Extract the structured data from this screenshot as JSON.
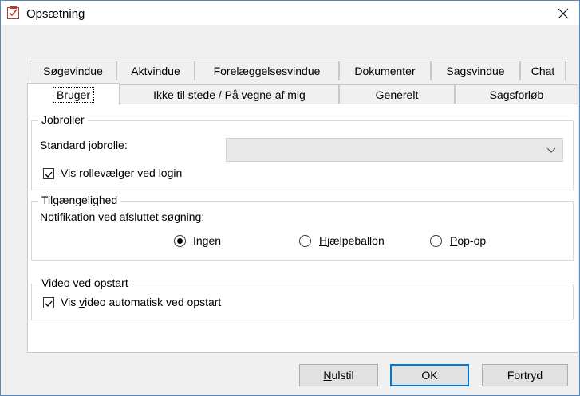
{
  "window": {
    "title": "Opsætning"
  },
  "tabs_row1": [
    "Søgevindue",
    "Aktvindue",
    "Forelæggelsesvindue",
    "Dokumenter",
    "Sagsvindue",
    "Chat"
  ],
  "tabs_row2": [
    "Bruger",
    "Ikke til stede / På vegne af mig",
    "Generelt",
    "Sagsforløb"
  ],
  "active_tab": "Bruger",
  "jobroller": {
    "legend": "Jobroller",
    "standard_label": "Standard jobrolle:",
    "standard_value": "",
    "show_role_selector": {
      "label_key": "V",
      "label_rest": "is rollevælger ved login",
      "checked": true
    }
  },
  "tilgaengelighed": {
    "legend": "Tilgængelighed",
    "notification_label": "Notifikation ved afsluttet søgning:",
    "options": [
      {
        "key": "",
        "rest": "Ingen",
        "selected": true
      },
      {
        "key": "H",
        "rest": "jælpeballon",
        "selected": false
      },
      {
        "key": "P",
        "rest": "op-op",
        "selected": false
      }
    ]
  },
  "video": {
    "legend": "Video ved opstart",
    "checkbox_pre": "Vis ",
    "checkbox_key": "v",
    "checkbox_rest": "ideo automatisk ved opstart",
    "checked": true
  },
  "buttons": {
    "reset_key": "N",
    "reset_rest": "ulstil",
    "ok": "OK",
    "cancel": "Fortryd"
  }
}
